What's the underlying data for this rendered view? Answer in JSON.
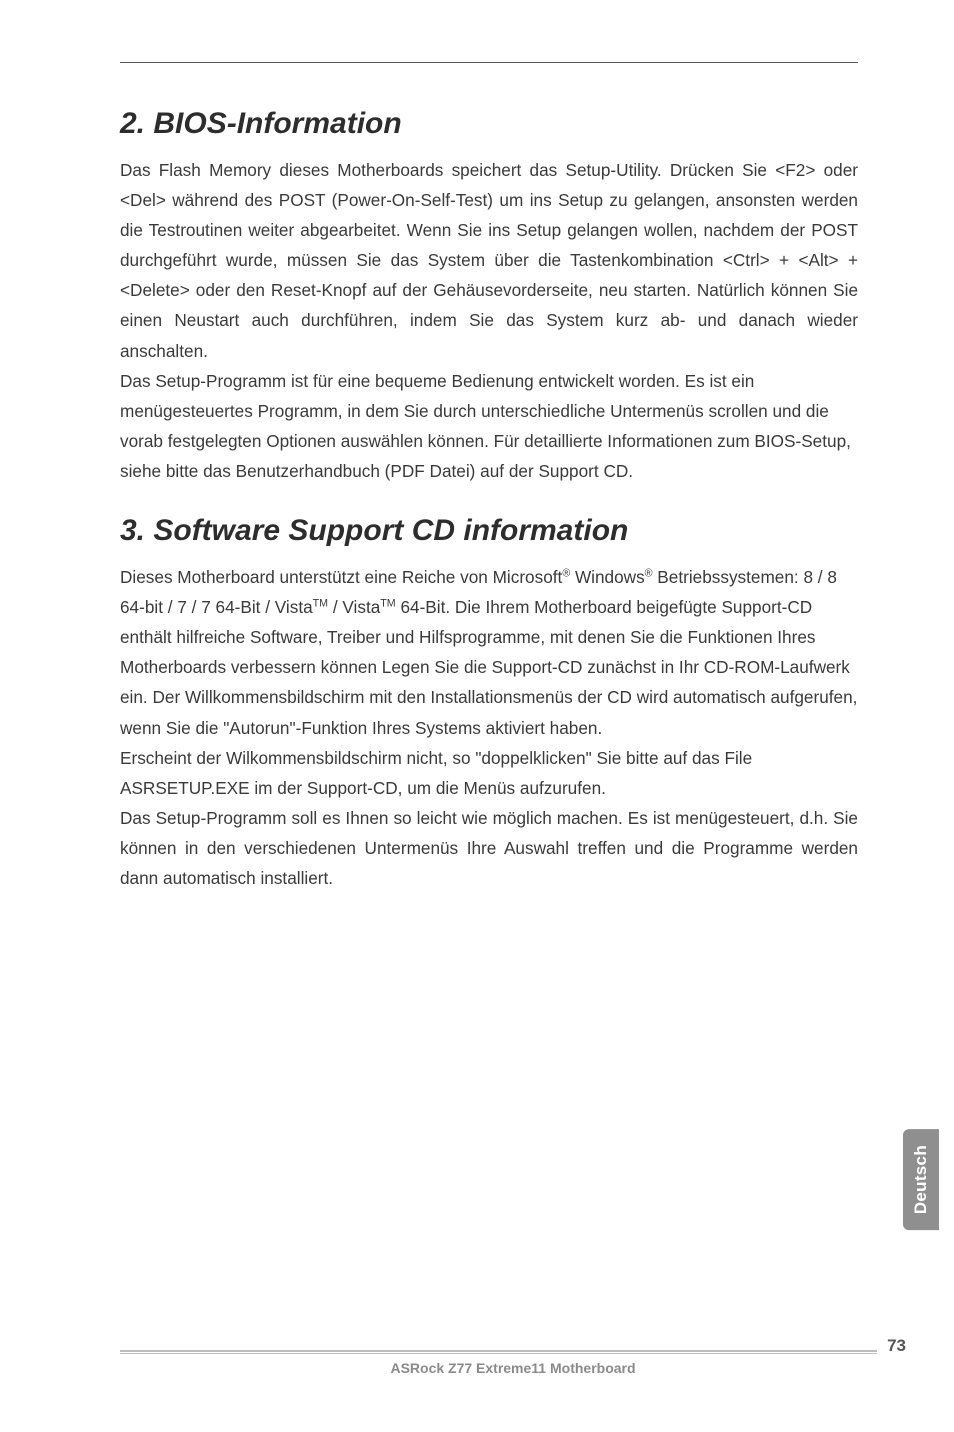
{
  "section2": {
    "heading": "2.  BIOS-Information",
    "para1": "Das Flash Memory dieses Motherboards speichert das Setup-Utility. Drücken Sie <F2> oder <Del> während des POST (Power-On-Self-Test) um ins Setup zu gelangen, ansonsten werden die Testroutinen weiter abgearbeitet. Wenn Sie ins Setup gelangen wollen, nachdem der POST durchgeführt wurde, müssen Sie das System über die Tastenkombination <Ctrl> + <Alt> + <Delete> oder den Reset-Knopf auf der Gehäusevorderseite, neu starten. Natürlich können Sie einen Neustart auch durchführen, indem Sie das System kurz ab- und danach wieder anschalten.",
    "para2": "Das Setup-Programm ist für eine bequeme Bedienung entwickelt worden. Es ist ein menügesteuertes Programm, in dem Sie durch unterschiedliche Untermenüs scrollen und die vorab festgelegten Optionen auswählen können. Für detaillierte Informationen zum BIOS-Setup, siehe bitte das Benutzerhandbuch (PDF Datei) auf der Support CD."
  },
  "section3": {
    "heading": "3.  Software Support CD information",
    "para1_pre": "Dieses Motherboard unterstützt eine Reiche von Microsoft",
    "para1_mid1": " Windows",
    "para1_mid2": " Betriebssystemen: 8 / 8 64-bit / 7 / 7 64-Bit / Vista",
    "para1_mid3": " / Vista",
    "para1_post": " 64-Bit. Die Ihrem Motherboard beigefügte Support-CD enthält hilfreiche Software, Treiber und Hilfsprogramme, mit denen Sie die Funktionen Ihres Motherboards verbessern können Legen Sie die Support-CD zunächst in Ihr CD-ROM-Laufwerk ein. Der Willkommensbildschirm mit den Installationsmenüs der CD wird automatisch aufgerufen, wenn Sie die \"Autorun\"-Funktion Ihres Systems aktiviert haben.",
    "para2": "Erscheint der Wilkommensbildschirm nicht, so \"doppelklicken\" Sie bitte auf das File ASRSETUP.EXE im der Support-CD, um die Menüs aufzurufen.",
    "para3": "Das Setup-Programm soll es Ihnen so leicht wie möglich machen. Es ist menügesteuert, d.h. Sie können in den verschiedenen Untermenüs Ihre Auswahl treffen und die Programme werden dann automatisch installiert."
  },
  "sup": {
    "reg": "®",
    "tm": "TM"
  },
  "sidebar": {
    "label": "Deutsch"
  },
  "footer": {
    "pagenum": "73",
    "text": "ASRock Z77 Extreme11 Motherboard"
  }
}
